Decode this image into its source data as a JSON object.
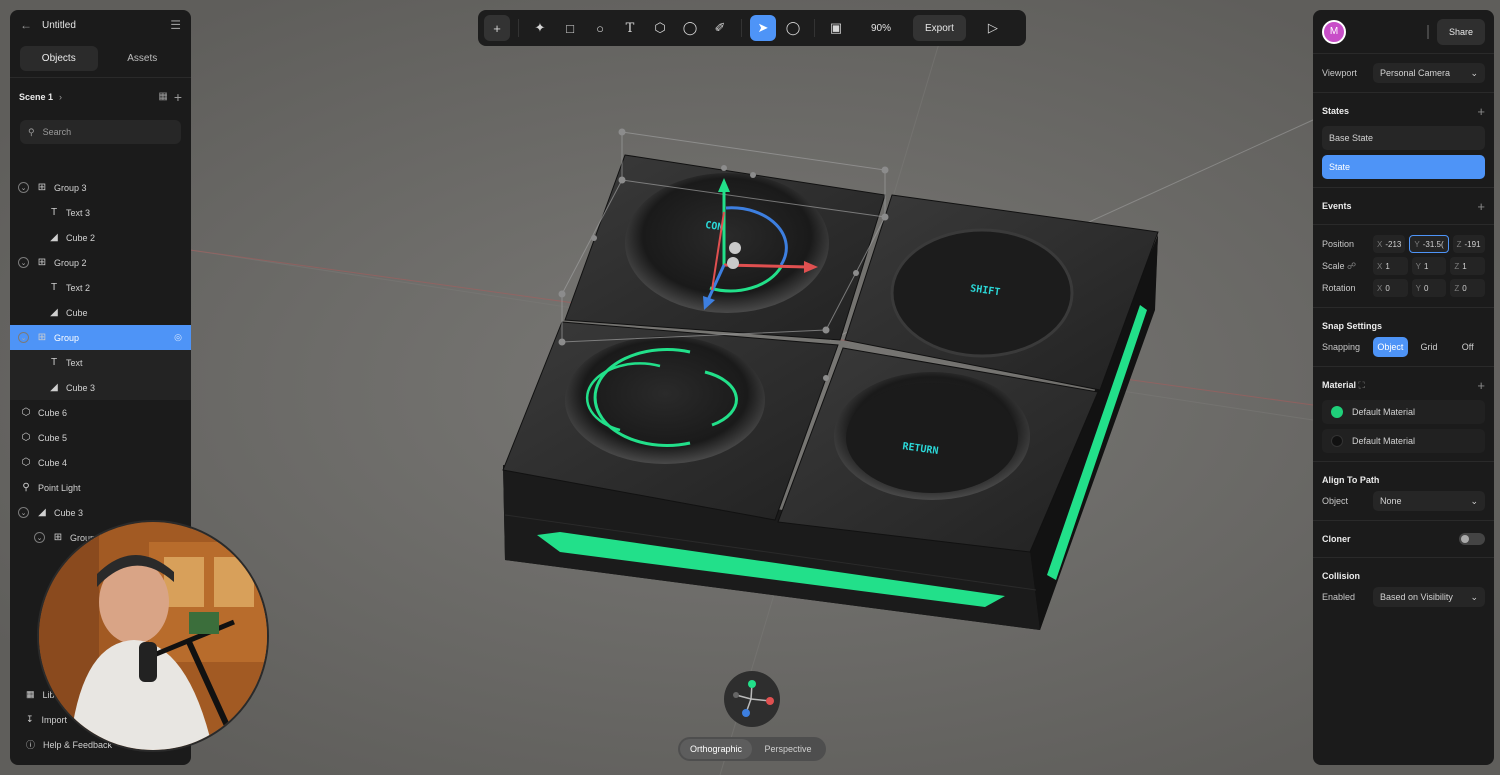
{
  "app": {
    "document_title": "Untitled"
  },
  "left_panel": {
    "tabs": [
      {
        "label": "Objects"
      },
      {
        "label": "Assets"
      }
    ],
    "scene": {
      "name": "Scene 1"
    },
    "search": {
      "placeholder": "Search"
    },
    "tree": [
      {
        "label": "Group 3",
        "icon": "group-icon",
        "expandable": true,
        "level": 0
      },
      {
        "label": "Text 3",
        "icon": "text-icon",
        "level": 1
      },
      {
        "label": "Cube 2",
        "icon": "cube-outline-icon",
        "level": 1
      },
      {
        "label": "Group 2",
        "icon": "group-icon",
        "expandable": true,
        "level": 0
      },
      {
        "label": "Text 2",
        "icon": "text-icon",
        "level": 1
      },
      {
        "label": "Cube",
        "icon": "cube-outline-icon",
        "level": 1
      },
      {
        "label": "Group",
        "icon": "group-icon",
        "expandable": true,
        "level": 0,
        "selected": true
      },
      {
        "label": "Text",
        "icon": "text-icon",
        "level": 1
      },
      {
        "label": "Cube 3",
        "icon": "cube-outline-icon",
        "level": 1
      },
      {
        "label": "Cube 6",
        "icon": "cube-icon",
        "level": 0
      },
      {
        "label": "Cube 5",
        "icon": "cube-icon",
        "level": 0
      },
      {
        "label": "Cube 4",
        "icon": "cube-icon",
        "level": 0
      },
      {
        "label": "Point Light",
        "icon": "light-bulb-icon",
        "level": 0
      },
      {
        "label": "Cube 3",
        "icon": "cube-outline-icon",
        "expandable": true,
        "level": 0
      },
      {
        "label": "Group 4",
        "icon": "group-icon",
        "expandable": true,
        "level": 1
      }
    ],
    "bottom": [
      {
        "label": "Lib",
        "icon": "library-icon"
      },
      {
        "label": "Import",
        "icon": "import-icon"
      },
      {
        "label": "Help & Feedback",
        "icon": "help-icon"
      }
    ]
  },
  "toolbar": {
    "zoom": "90%",
    "export_label": "Export"
  },
  "viewport": {
    "key_labels": [
      "CON",
      "SHIFT",
      "RETURN"
    ],
    "projection": [
      {
        "label": "Orthographic",
        "active": true
      },
      {
        "label": "Perspective",
        "active": false
      }
    ]
  },
  "right_panel": {
    "avatar_initial": "M",
    "share_label": "Share",
    "viewport": {
      "label": "Viewport",
      "value": "Personal Camera"
    },
    "states": {
      "title": "States",
      "items": [
        {
          "label": "Base State",
          "active": false
        },
        {
          "label": "State",
          "active": true
        }
      ]
    },
    "events": {
      "title": "Events"
    },
    "transform": {
      "position": {
        "label": "Position",
        "x": "-213",
        "y": "-31.5(",
        "z": "-191"
      },
      "scale": {
        "label": "Scale",
        "x": "1",
        "y": "1",
        "z": "1"
      },
      "rotation": {
        "label": "Rotation",
        "x": "0",
        "y": "0",
        "z": "0"
      }
    },
    "snap": {
      "title": "Snap Settings",
      "label": "Snapping",
      "options": [
        {
          "label": "Object",
          "active": true
        },
        {
          "label": "Grid",
          "active": false
        },
        {
          "label": "Off",
          "active": false
        }
      ]
    },
    "material": {
      "title": "Material",
      "items": [
        {
          "label": "Default Material",
          "color": "#1fd07a"
        },
        {
          "label": "Default Material",
          "color": "#111111"
        }
      ]
    },
    "align_to_path": {
      "title": "Align To Path",
      "label": "Object",
      "value": "None"
    },
    "cloner": {
      "title": "Cloner",
      "enabled": false
    },
    "collision": {
      "title": "Collision",
      "label": "Enabled",
      "value": "Based on Visibility"
    }
  },
  "colors": {
    "accent": "#4e94f7",
    "neon": "#22e08a",
    "panel": "#1b1b1b",
    "canvas": "#6e6d6a"
  }
}
